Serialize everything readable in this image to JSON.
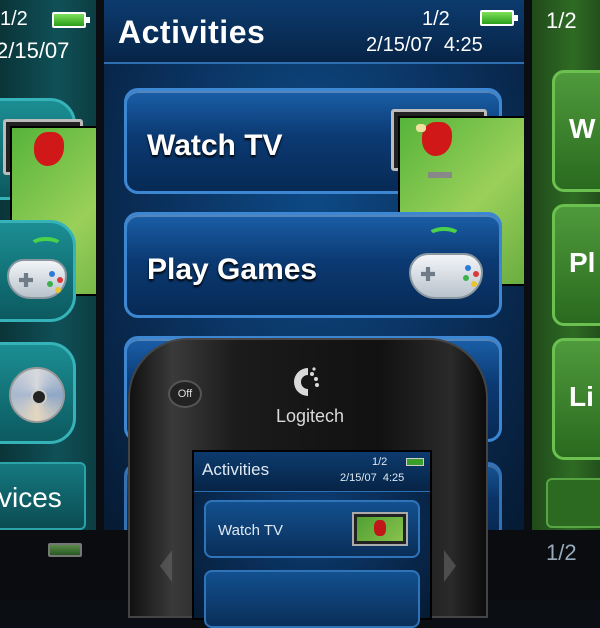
{
  "left_panel": {
    "page": "1/2",
    "date": "2/15/07",
    "footer_label": "vices"
  },
  "main": {
    "title": "Activities",
    "page": "1/2",
    "date": "2/15/07",
    "time": "4:25",
    "activities": [
      {
        "label": "Watch TV",
        "icon": "tv-icon"
      },
      {
        "label": "Play Games",
        "icon": "gamepad-icon"
      },
      {
        "label": "",
        "icon": ""
      }
    ]
  },
  "right_panel": {
    "page": "1/2",
    "items": [
      "W",
      "Pl",
      "Li"
    ]
  },
  "bottom": {
    "page": "1/2"
  },
  "device": {
    "off_label": "Off",
    "brand": "Logitech",
    "screen": {
      "title": "Activities",
      "page": "1/2",
      "date": "2/15/07",
      "time": "4:25",
      "activity_1": "Watch TV"
    }
  },
  "colors": {
    "blue_theme": "#0a2f5a",
    "teal_theme": "#0f5157",
    "green_theme": "#2f6b24",
    "battery": "#4cbf2f"
  }
}
